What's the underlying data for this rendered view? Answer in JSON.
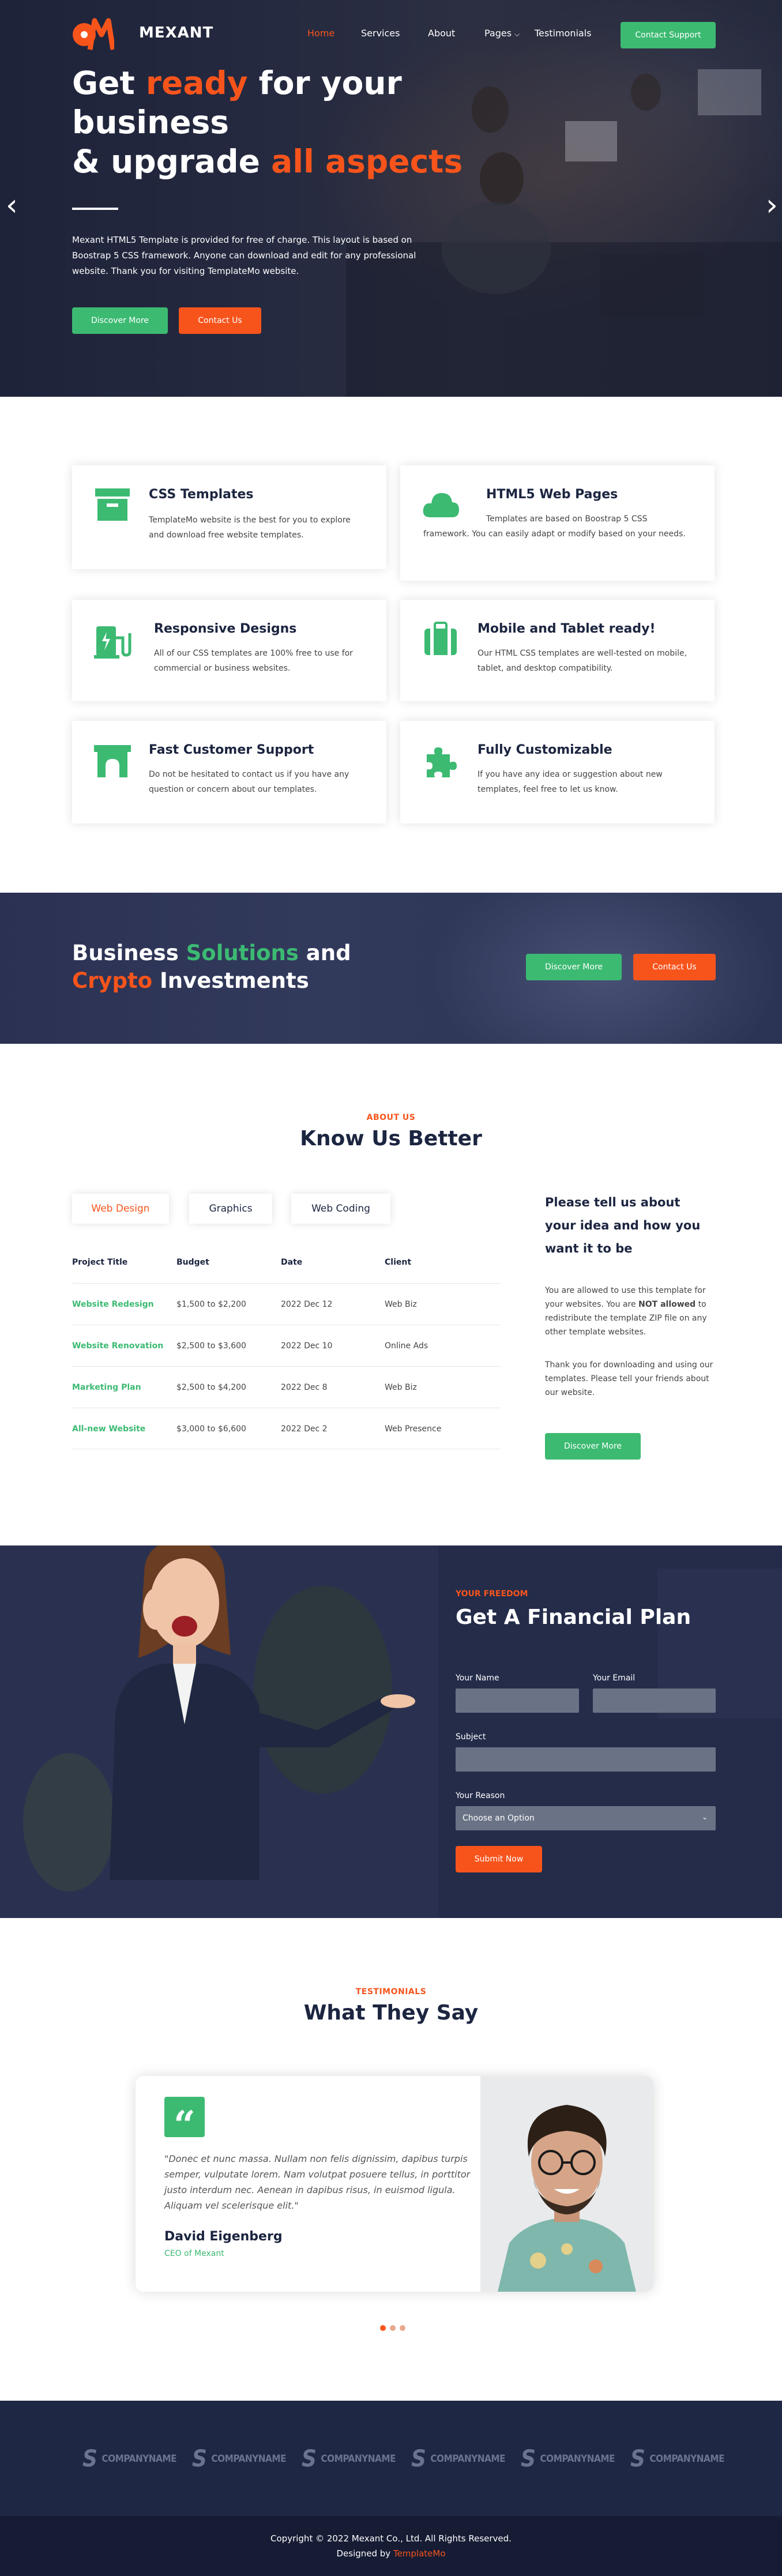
{
  "brand": {
    "name": "MEXANT"
  },
  "nav": {
    "items": [
      "Home",
      "Services",
      "About",
      "Pages",
      "Testimonials"
    ],
    "contact_label": "Contact Support"
  },
  "hero": {
    "line1_a": "Get ",
    "line1_hl": "ready",
    "line1_b": " for your",
    "line2": "business",
    "line3_a": "& upgrade ",
    "line3_hl": "all aspects",
    "paragraph": "Mexant HTML5 Template is provided for free of charge. This layout is based on Boostrap 5 CSS framework. Anyone can download and edit for any professional website. Thank you for visiting TemplateMo website.",
    "discover_label": "Discover More",
    "contact_label": "Contact Us",
    "prev_icon": "‹",
    "next_icon": "›"
  },
  "services": [
    {
      "title": "CSS Templates",
      "desc": "TemplateMo website is the best for you to explore and download free website templates.",
      "icon": "archive-icon"
    },
    {
      "title": "HTML5 Web Pages",
      "desc": "Templates are based on Boostrap 5 CSS framework. You can easily adapt or modify based on your needs.",
      "icon": "cloud-icon"
    },
    {
      "title": "Responsive Designs",
      "desc": "All of our CSS templates are 100% free to use for commercial or business websites.",
      "icon": "charging-station-icon"
    },
    {
      "title": "Mobile and Tablet ready!",
      "desc": "Our HTML CSS templates are well-tested on mobile, tablet, and desktop compatibility.",
      "icon": "suitcase-icon"
    },
    {
      "title": "Fast Customer Support",
      "desc": "Do not be hesitated to contact us if you have any question or concern about our templates.",
      "icon": "archway-icon"
    },
    {
      "title": "Fully Customizable",
      "desc": "If you have any idea or suggestion about new templates, feel free to let us know.",
      "icon": "puzzle-icon"
    }
  ],
  "banner": {
    "l1_a": "Business ",
    "l1_hl": "Solutions",
    "l1_b": " and",
    "l2_hl": "Crypto",
    "l2_b": " Investments",
    "discover_label": "Discover More",
    "contact_label": "Contact Us"
  },
  "about": {
    "eyebrow": "ABOUT US",
    "heading": "Know Us Better",
    "tabs": [
      "Web Design",
      "Graphics",
      "Web Coding"
    ],
    "columns": [
      "Project Title",
      "Budget",
      "Date",
      "Client"
    ],
    "rows": [
      [
        "Website Redesign",
        "$1,500 to $2,200",
        "2022 Dec 12",
        "Web Biz"
      ],
      [
        "Website Renovation",
        "$2,500 to $3,600",
        "2022 Dec 10",
        "Online Ads"
      ],
      [
        "Marketing Plan",
        "$2,500 to $4,200",
        "2022 Dec 8",
        "Web Biz"
      ],
      [
        "All-new Website",
        "$3,000 to $6,600",
        "2022 Dec 2",
        "Web Presence"
      ]
    ],
    "side_heading": "Please tell us about your idea and how you want it to be",
    "side_p1_a": "You are allowed to use this template for your websites. You are ",
    "side_p1_b": "NOT allowed",
    "side_p1_c": " to redistribute the template ZIP file on any other template websites.",
    "side_p2": "Thank you for downloading and using our templates. Please tell your friends about our website.",
    "discover_label": "Discover More"
  },
  "plan": {
    "eyebrow": "YOUR FREEDOM",
    "heading": "Get A Financial Plan",
    "name_label": "Your Name",
    "email_label": "Your Email",
    "subject_label": "Subject",
    "reason_label": "Your Reason",
    "reason_selected": "Choose an Option",
    "submit_label": "Submit Now"
  },
  "testimonials": {
    "eyebrow": "TESTIMONIALS",
    "heading": "What They Say",
    "quote_mark": "“",
    "quote": "\"Donec et nunc massa. Nullam non felis dignissim, dapibus turpis semper, vulputate lorem. Nam volutpat posuere tellus, in porttitor justo interdum nec. Aenean in dapibus risus, in euismod ligula. Aliquam vel scelerisque elit.\"",
    "name": "David Eigenberg",
    "role": "CEO of Mexant"
  },
  "clients": [
    "COMPANYNAME",
    "COMPANYNAME",
    "COMPANYNAME",
    "COMPANYNAME",
    "COMPANYNAME",
    "COMPANYNAME"
  ],
  "footer": {
    "copyright": "Copyright © 2022 Mexant Co., Ltd. All Rights Reserved.",
    "designed_by": "Designed by ",
    "designer": "TemplateMo"
  },
  "colors": {
    "accent": "#f7541c",
    "green": "#3cba72",
    "navy": "#1e2744"
  }
}
